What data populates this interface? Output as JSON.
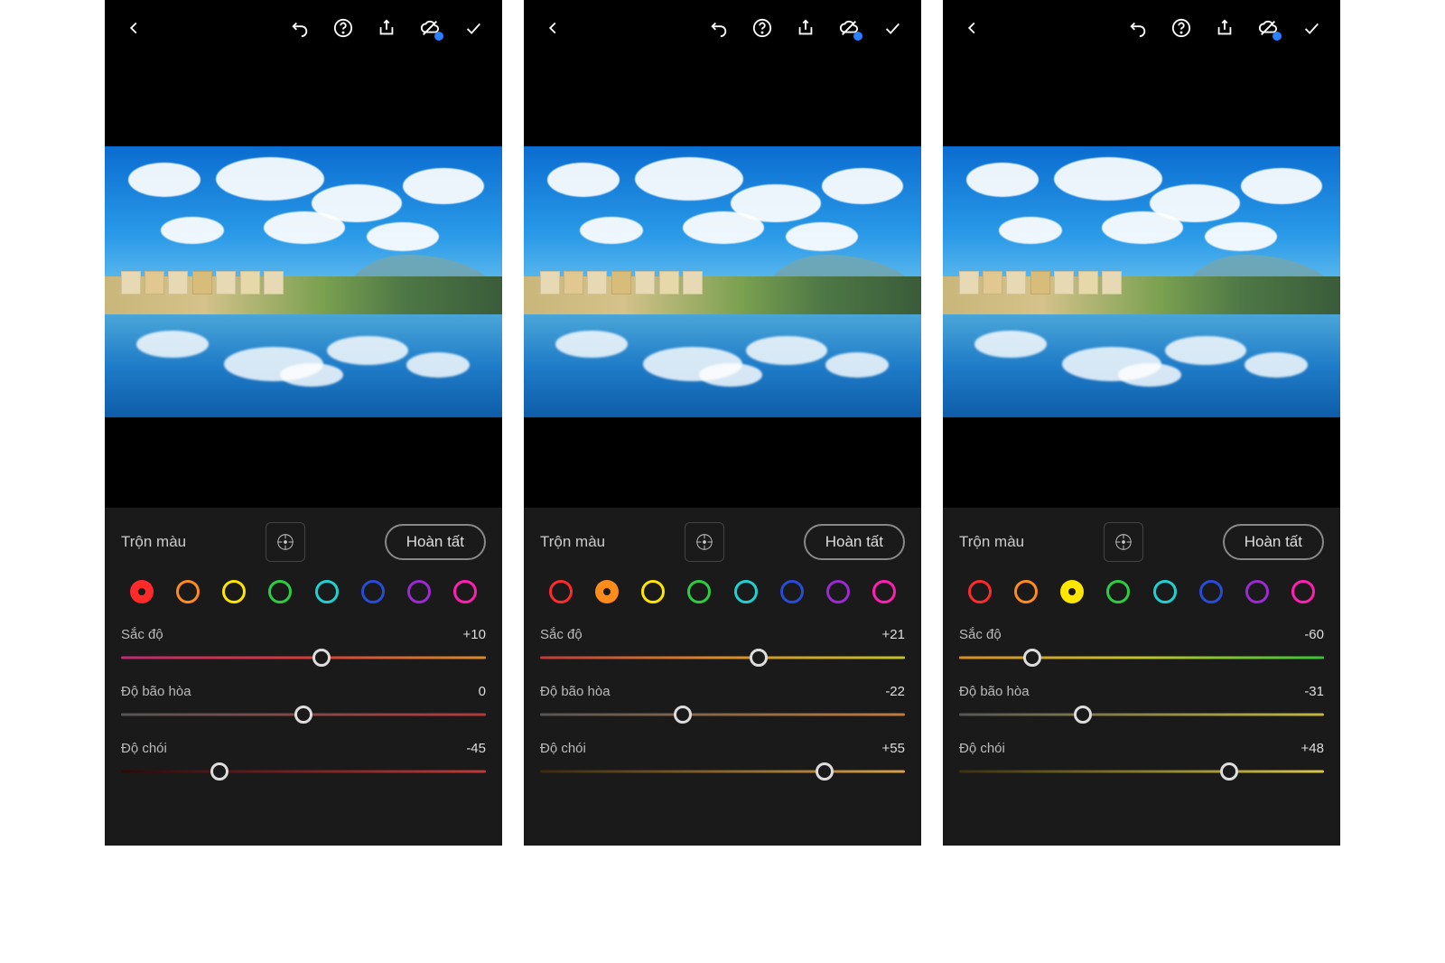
{
  "panels": [
    {
      "title": "Trộn màu",
      "done": "Hoàn tất",
      "selectedColor": 0,
      "colors": [
        "#ff2b2b",
        "#ff8c1a",
        "#ffe600",
        "#2ecc40",
        "#1fd1d1",
        "#2a4bd6",
        "#9b2bd1",
        "#ff1fb0"
      ],
      "sliders": [
        {
          "label": "Sắc độ",
          "value": "+10",
          "pos": 55,
          "grad": "linear-gradient(to right,#c02a70,#d43a3a,#d88c2a)"
        },
        {
          "label": "Độ bão hòa",
          "value": "0",
          "pos": 50,
          "grad": "linear-gradient(to right,#555,#b33a3a)"
        },
        {
          "label": "Độ chói",
          "value": "-45",
          "pos": 27,
          "grad": "linear-gradient(to right,#2a0a0a,#c23a3a)"
        }
      ]
    },
    {
      "title": "Trộn màu",
      "done": "Hoàn tất",
      "selectedColor": 1,
      "colors": [
        "#ff2b2b",
        "#ff8c1a",
        "#ffe600",
        "#2ecc40",
        "#1fd1d1",
        "#2a4bd6",
        "#9b2bd1",
        "#ff1fb0"
      ],
      "sliders": [
        {
          "label": "Sắc độ",
          "value": "+21",
          "pos": 60,
          "grad": "linear-gradient(to right,#c23a3a,#d88c2a,#bfc22a)"
        },
        {
          "label": "Độ bão hòa",
          "value": "-22",
          "pos": 39,
          "grad": "linear-gradient(to right,#555,#c27a3a)"
        },
        {
          "label": "Độ chói",
          "value": "+55",
          "pos": 78,
          "grad": "linear-gradient(to right,#3a2a10,#d8a04a)"
        }
      ]
    },
    {
      "title": "Trộn màu",
      "done": "Hoàn tất",
      "selectedColor": 2,
      "colors": [
        "#ff2b2b",
        "#ff8c1a",
        "#ffe600",
        "#2ecc40",
        "#1fd1d1",
        "#2a4bd6",
        "#9b2bd1",
        "#ff1fb0"
      ],
      "sliders": [
        {
          "label": "Sắc độ",
          "value": "-60",
          "pos": 20,
          "grad": "linear-gradient(to right,#d88c2a,#bfc22a,#3ac23a)"
        },
        {
          "label": "Độ bão hòa",
          "value": "-31",
          "pos": 34,
          "grad": "linear-gradient(to right,#555,#c2b83a)"
        },
        {
          "label": "Độ chói",
          "value": "+48",
          "pos": 74,
          "grad": "linear-gradient(to right,#3a3010,#d8c84a)"
        }
      ]
    }
  ]
}
